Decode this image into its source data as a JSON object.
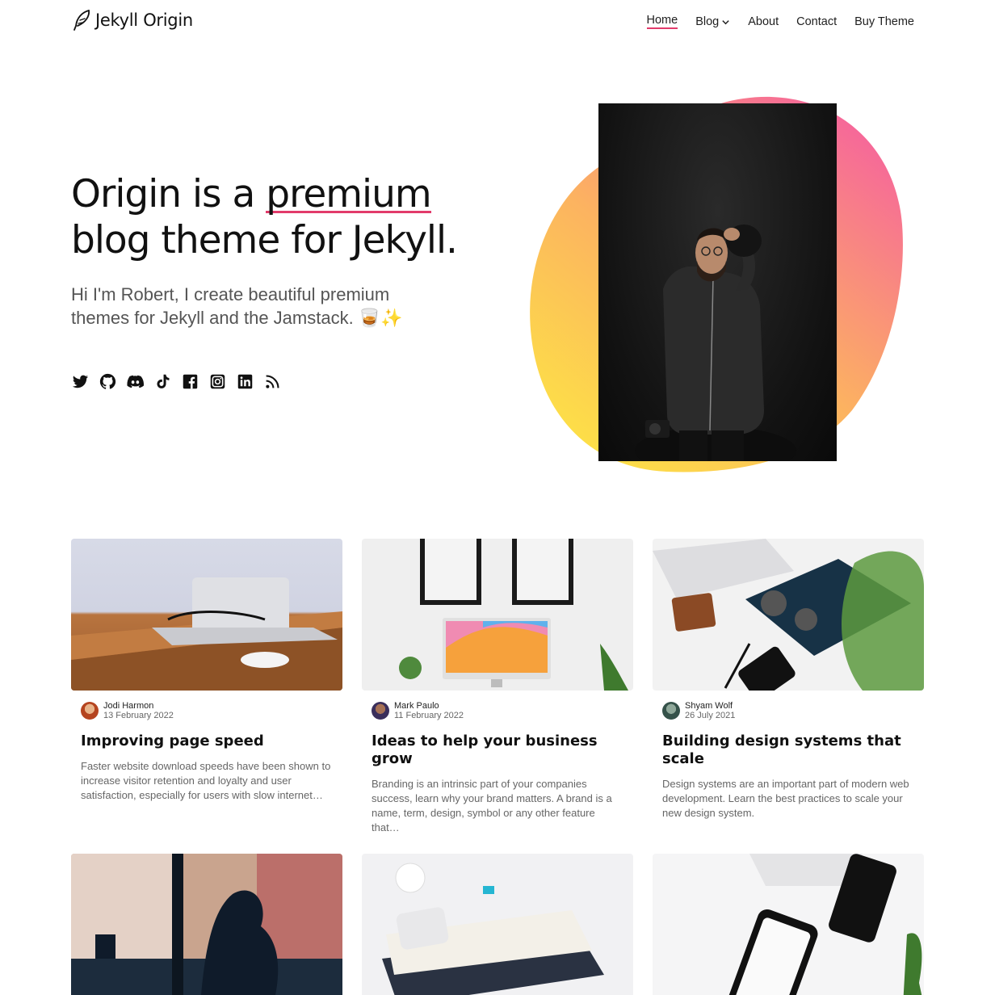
{
  "brand": {
    "name": "Jekyll Origin"
  },
  "nav": {
    "items": [
      {
        "label": "Home",
        "active": true
      },
      {
        "label": "Blog",
        "has_dropdown": true
      },
      {
        "label": "About"
      },
      {
        "label": "Contact"
      },
      {
        "label": "Buy Theme"
      }
    ]
  },
  "hero": {
    "title_part1": "Origin is a ",
    "title_highlight": "premium",
    "title_part2": "blog theme for Jekyll.",
    "subtitle": "Hi I'm Robert, I create beautiful premium themes for Jekyll and the Jamstack. 🥃✨",
    "socials": [
      "twitter-icon",
      "github-icon",
      "discord-icon",
      "tiktok-icon",
      "facebook-icon",
      "instagram-icon",
      "linkedin-icon",
      "rss-icon"
    ]
  },
  "colors": {
    "accent": "#e23b6b",
    "blob_top": "#f6679a",
    "blob_bottom": "#fde047"
  },
  "posts": [
    {
      "author": "Jodi Harmon",
      "date": "13 February 2022",
      "title": "Improving page speed",
      "excerpt": "Faster website download speeds have been shown to increase visitor retention and loyalty and user satisfaction, especially for users with slow internet…"
    },
    {
      "author": "Mark Paulo",
      "date": "11 February 2022",
      "title": "Ideas to help your business grow",
      "excerpt": "Branding is an intrinsic part of your companies success, learn why your brand matters. A brand is a name, term, design, symbol or any other feature that…"
    },
    {
      "author": "Shyam Wolf",
      "date": "26 July 2021",
      "title": "Building design systems that scale",
      "excerpt": "Design systems are an important part of modern web development. Learn the best practices to scale your new design system."
    }
  ]
}
